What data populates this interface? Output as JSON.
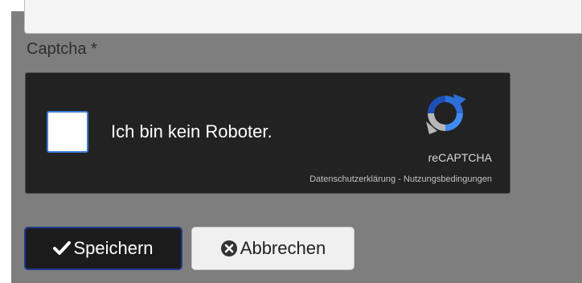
{
  "form": {
    "prev_input_value": "",
    "captcha_label": "Captcha *"
  },
  "recaptcha": {
    "checkbox_label": "Ich bin kein Roboter.",
    "checked": false,
    "brand": "reCAPTCHA",
    "privacy_link": "Datenschutzerklärung",
    "separator": " - ",
    "terms_link": "Nutzungsbedingungen",
    "logo_icon": "recaptcha-logo-icon"
  },
  "actions": {
    "save_label": "Speichern",
    "save_icon": "checkmark-icon",
    "cancel_label": "Abbrechen",
    "cancel_icon": "close-circle-icon"
  },
  "colors": {
    "page_bg": "#7e7e7e",
    "widget_bg": "#222222",
    "checkbox_border": "#3d7bd6",
    "save_border": "#1f3a8a"
  }
}
